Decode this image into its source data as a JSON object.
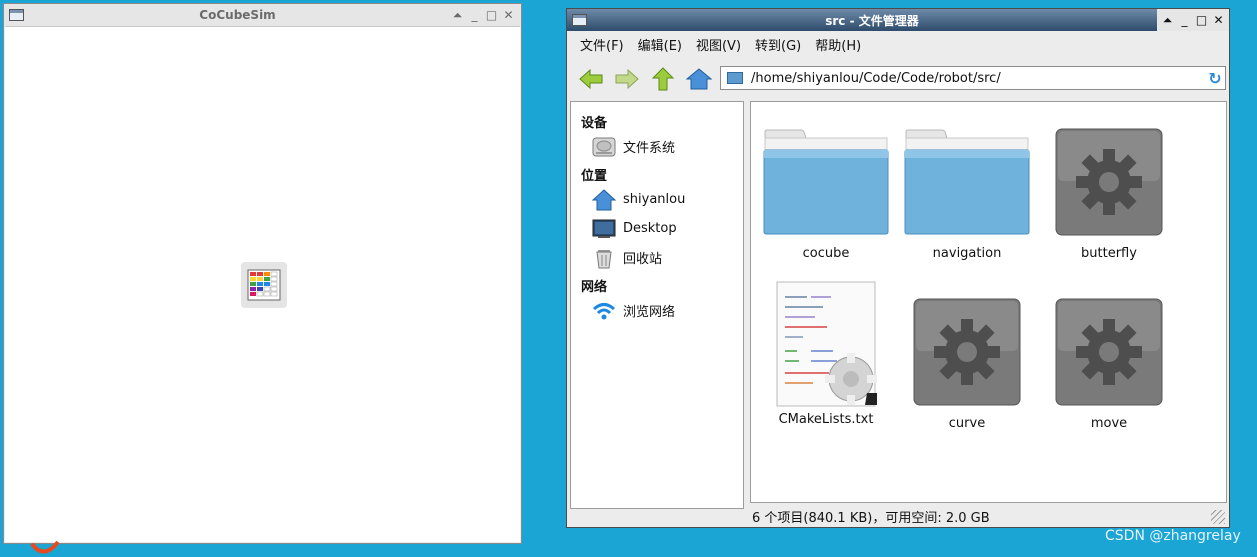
{
  "left_window": {
    "title": "CoCubeSim",
    "controls": [
      "⏶",
      "_",
      "□",
      "✕"
    ]
  },
  "file_manager": {
    "title": "src - 文件管理器",
    "controls": [
      "⏶",
      "_",
      "□",
      "✕"
    ],
    "menu": [
      "文件(F)",
      "编辑(E)",
      "视图(V)",
      "转到(G)",
      "帮助(H)"
    ],
    "toolbar": {
      "back_icon": "arrow-left-icon",
      "forward_icon": "arrow-right-icon",
      "up_icon": "arrow-up-icon",
      "home_icon": "home-icon"
    },
    "address": "/home/shiyanlou/Code/Code/robot/src/",
    "sidebar": {
      "sections": [
        {
          "heading": "设备",
          "items": [
            {
              "label": "文件系统",
              "icon": "hard-drive-icon"
            }
          ]
        },
        {
          "heading": "位置",
          "items": [
            {
              "label": "shiyanlou",
              "icon": "home-icon"
            },
            {
              "label": "Desktop",
              "icon": "desktop-icon"
            },
            {
              "label": "回收站",
              "icon": "trash-icon"
            }
          ]
        },
        {
          "heading": "网络",
          "items": [
            {
              "label": "浏览网络",
              "icon": "wifi-icon"
            }
          ]
        }
      ]
    },
    "files": [
      {
        "name": "cocube",
        "icon": "folder-icon"
      },
      {
        "name": "navigation",
        "icon": "folder-icon"
      },
      {
        "name": "butterfly",
        "icon": "executable-gear-icon"
      },
      {
        "name": "CMakeLists.txt",
        "icon": "text-file-gear-icon"
      },
      {
        "name": "curve",
        "icon": "executable-gear-icon"
      },
      {
        "name": "move",
        "icon": "executable-gear-icon"
      }
    ],
    "status": "6 个项目(840.1 KB)，可用空间: 2.0 GB"
  },
  "watermark": "CSDN @zhangrelay",
  "colors": {
    "desktop": "#1aa5d4",
    "titlebar_active": "#3d5a7c",
    "folder": "#6fb2dc"
  }
}
